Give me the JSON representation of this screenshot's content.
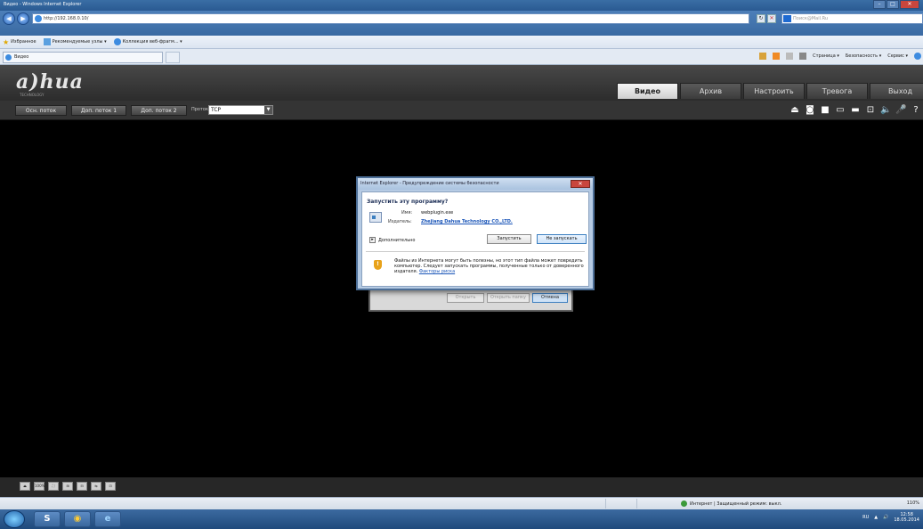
{
  "window": {
    "title": "Видео - Windows Internet Explorer",
    "address": "http://192.168.0.10/",
    "search_placeholder": "Поиск@Mail.Ru"
  },
  "favorites": {
    "label": "Избранное",
    "items": [
      "Рекомендуемые узлы ▾",
      "Коллекция веб-фрагм... ▾"
    ]
  },
  "tab": {
    "label": "Видео"
  },
  "commandbar": {
    "items": [
      "Страница ▾",
      "Безопасность ▾",
      "Сервис ▾"
    ]
  },
  "app": {
    "logo": "a)hua",
    "logo_sub": "TECHNOLOGY",
    "nav": [
      {
        "label": "Видео",
        "active": true
      },
      {
        "label": "Архив",
        "active": false
      },
      {
        "label": "Настроить",
        "active": false
      },
      {
        "label": "Тревога",
        "active": false
      },
      {
        "label": "Выход",
        "active": false
      }
    ],
    "streams": [
      "Осн. поток",
      "Доп. поток 1",
      "Доп. поток 2"
    ],
    "protocol_label": "Протокол",
    "protocol_value": "TCP",
    "bottom_tools": [
      "⏏",
      "100%",
      "⛶",
      "⊞",
      "⊟",
      "⇆",
      "⊡"
    ]
  },
  "security_dialog": {
    "title": "Internet Explorer - Предупреждение системы безопасности",
    "question": "Запустить эту программу?",
    "name_label": "Имя:",
    "name_value": "webplugin.exe",
    "publisher_label": "Издатель:",
    "publisher_value": "Zhejiang Dahua Technology  CO.,LTD.",
    "more_label": "Дополнительно",
    "run_button": "Запустить",
    "dont_run_button": "Не запускать",
    "warning_text": "Файлы из Интернета могут быть полезны, но этот тип файла может повредить компьютер. Следует запускать программы, полученные только от доверенного издателя.",
    "risk_link": "Факторы риска"
  },
  "download_dialog": {
    "open_button": "Открыть",
    "open_folder_button": "Открыть папку",
    "cancel_button": "Отмена"
  },
  "statusbar": {
    "zone": "Интернет | Защищенный режим: выкл.",
    "zoom": "110%"
  },
  "taskbar": {
    "lang": "RU",
    "time": "12:58",
    "date": "18.05.2014"
  },
  "colors": {
    "accent_link": "#1a55b8",
    "nav_active_bg": "#e0e0e0",
    "app_header_bg": "#343434"
  }
}
